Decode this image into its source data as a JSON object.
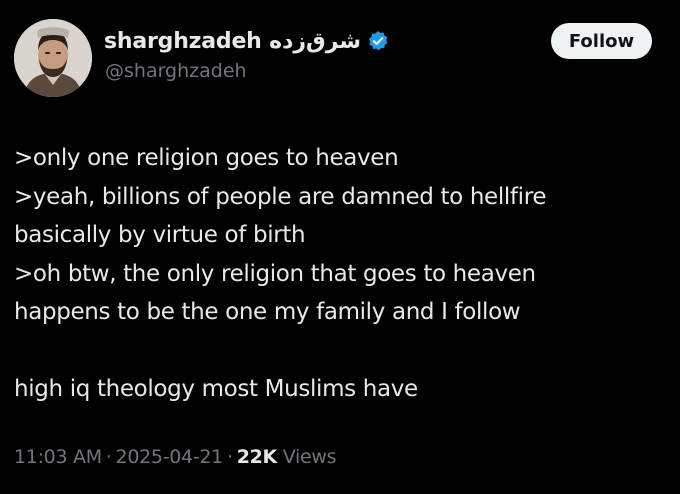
{
  "author": {
    "display_name": "sharghzadeh شرق‌زده",
    "handle": "@sharghzadeh",
    "verified": true,
    "avatar_icon": "profile-photo-avatar",
    "verified_icon": "verified-badge-icon"
  },
  "follow_button": {
    "label": "Follow"
  },
  "tweet": {
    "lines": [
      ">only one religion goes to heaven",
      ">yeah, billions of people are damned to hellfire",
      "basically by virtue of birth",
      ">oh btw, the only religion that goes to heaven",
      "happens to be the one my family and I follow",
      "",
      "high iq theology most Muslims have"
    ]
  },
  "meta": {
    "time": "11:03 AM",
    "separator": "·",
    "date": "2025-04-21",
    "views_count": "22K",
    "views_label": "Views"
  },
  "colors": {
    "background": "#000000",
    "primary_text": "#e7e9ea",
    "secondary_text": "#71767b",
    "verified_blue": "#1d9bf0",
    "follow_button_bg": "#eff3f4",
    "follow_button_text": "#0f1419"
  }
}
